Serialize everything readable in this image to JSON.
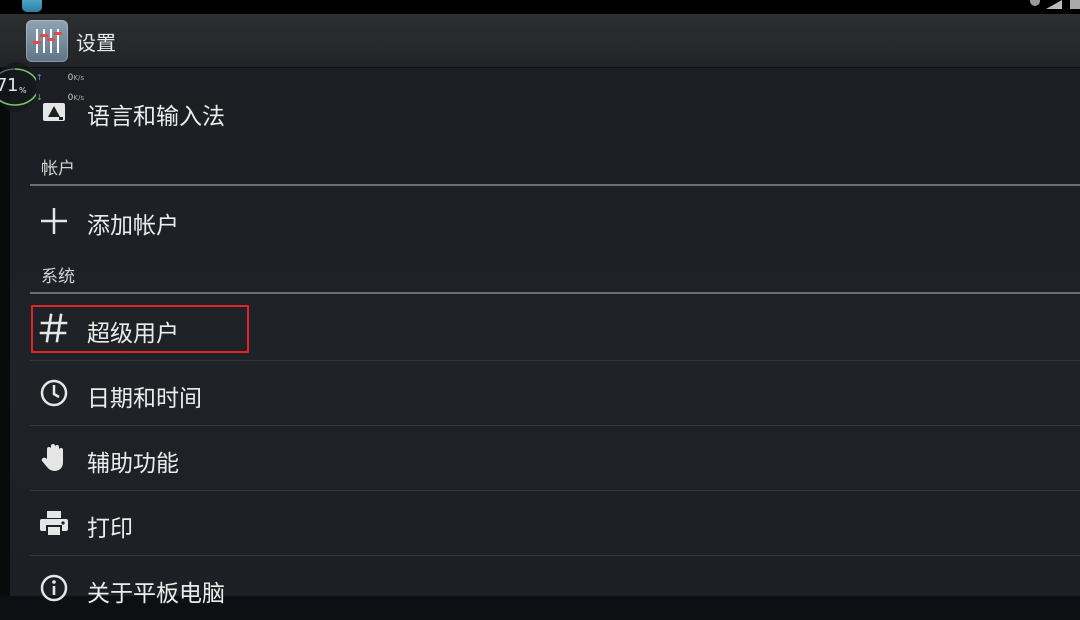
{
  "app": {
    "title": "设置",
    "icon": "settings-sliders-icon"
  },
  "overlay": {
    "cpu_percent": "71",
    "percent_sign": "%",
    "upload_speed": "0",
    "download_speed": "0",
    "speed_unit": "K/s"
  },
  "items": {
    "language": {
      "label": "语言和输入法",
      "icon": "keyboard-icon"
    },
    "add_account": {
      "label": "添加帐户",
      "icon": "plus-icon"
    },
    "superuser": {
      "label": "超级用户",
      "icon": "hash-icon"
    },
    "date_time": {
      "label": "日期和时间",
      "icon": "clock-icon"
    },
    "accessibility": {
      "label": "辅助功能",
      "icon": "hand-icon"
    },
    "printing": {
      "label": "打印",
      "icon": "printer-icon"
    },
    "about": {
      "label": "关于平板电脑",
      "icon": "info-icon"
    }
  },
  "sections": {
    "accounts": "帐户",
    "system": "系统"
  },
  "colors": {
    "highlight": "#e3232a",
    "background": "#1d2024",
    "text": "#ececec"
  }
}
